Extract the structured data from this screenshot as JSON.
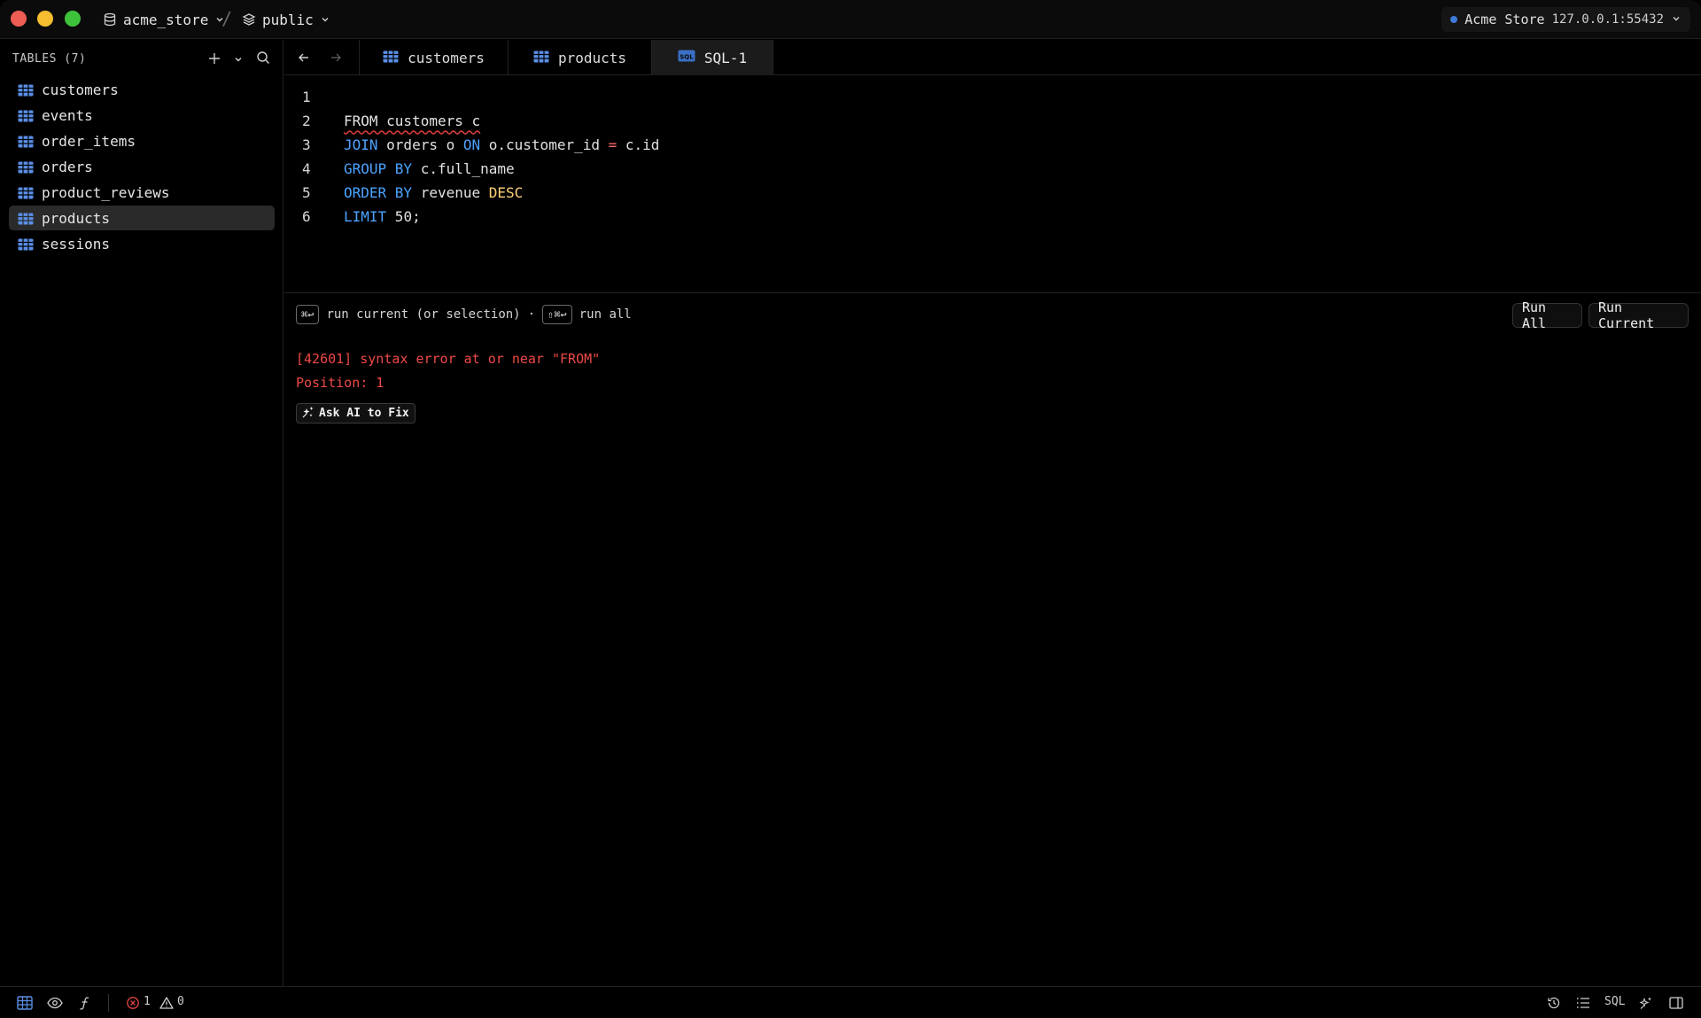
{
  "titlebar": {
    "database": "acme_store",
    "separator": "/",
    "schema": "public",
    "connection_name": "Acme Store",
    "connection_host": "127.0.0.1:55432"
  },
  "sidebar": {
    "heading": "TABLES (7)",
    "items": [
      {
        "label": "customers"
      },
      {
        "label": "events"
      },
      {
        "label": "order_items"
      },
      {
        "label": "orders"
      },
      {
        "label": "product_reviews"
      },
      {
        "label": "products"
      },
      {
        "label": "sessions"
      }
    ],
    "active_item": "products"
  },
  "tabs": [
    {
      "label": "customers",
      "icon": "table-icon"
    },
    {
      "label": "products",
      "icon": "table-icon"
    },
    {
      "label": "SQL-1",
      "icon": "sql-icon",
      "active": true
    }
  ],
  "editor": {
    "lines": [
      {
        "num": "1",
        "text": ""
      },
      {
        "num": "2",
        "text": "FROM customers c"
      },
      {
        "num": "3",
        "text": "JOIN orders o ON o.customer_id = c.id"
      },
      {
        "num": "4",
        "text": "GROUP BY c.full_name"
      },
      {
        "num": "5",
        "text": "ORDER BY revenue DESC"
      },
      {
        "num": "6",
        "text": "LIMIT 50;"
      }
    ]
  },
  "runbar": {
    "kbd_current": "⌘↩",
    "hint_current": "run current (or selection)",
    "hint_sep": "·",
    "kbd_all": "⇧⌘↩",
    "hint_all": "run all",
    "run_all_label": "Run All",
    "run_current_label": "Run Current"
  },
  "error": {
    "message": "[42601] syntax error at or near \"FROM\"",
    "position": "Position: 1",
    "ask_ai_label": "Ask AI to Fix"
  },
  "statusbar": {
    "error_count": "1",
    "warning_count": "0",
    "sql_label": "SQL"
  },
  "colors": {
    "accent": "#4da3ff",
    "error": "#f04848",
    "keyword": "#4da3ff",
    "keyword_alt": "#ffd27a",
    "table_icon": "#5a8fe6"
  }
}
